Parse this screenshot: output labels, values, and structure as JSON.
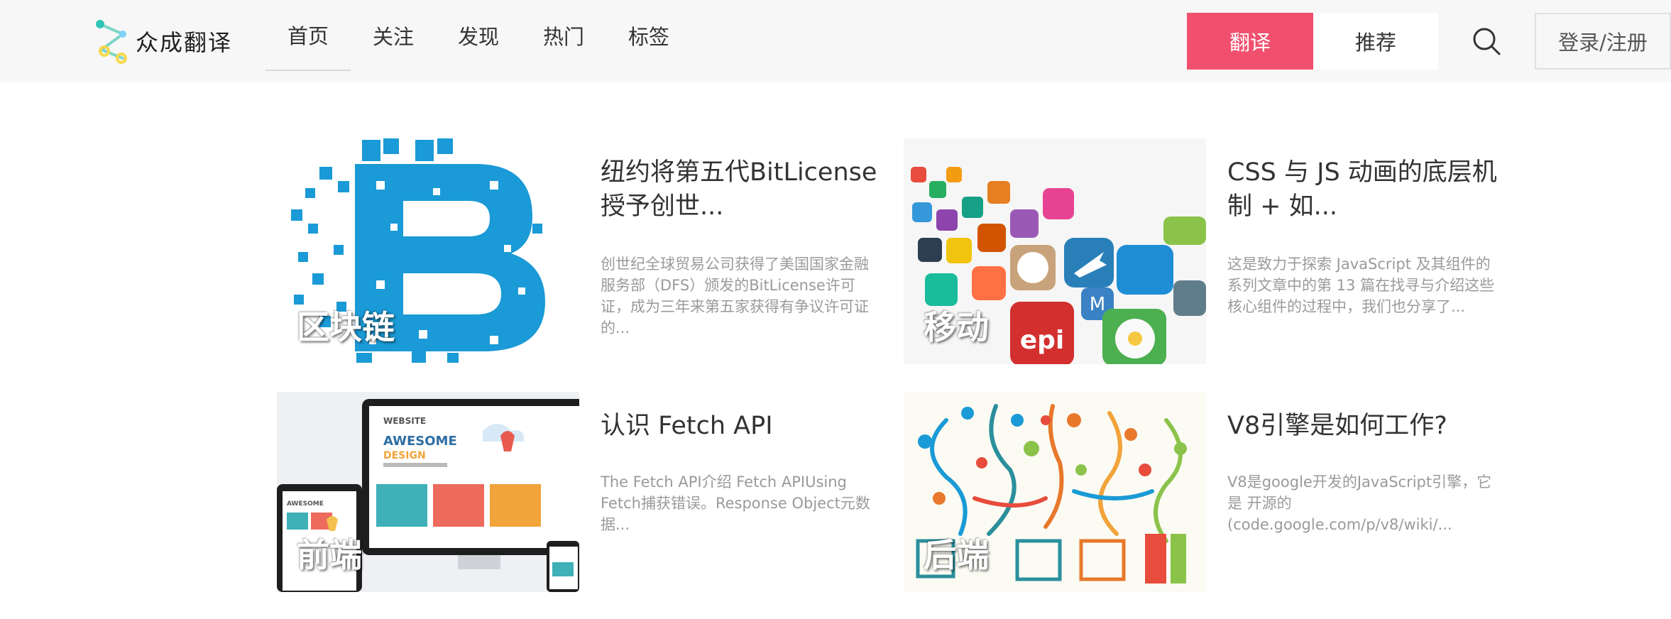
{
  "header": {
    "logo_text": "众成翻译",
    "nav": [
      "首页",
      "关注",
      "发现",
      "热门",
      "标签"
    ],
    "translate_label": "翻译",
    "recommend_label": "推荐",
    "login_label": "登录/注册"
  },
  "colors": {
    "accent": "#f0506e",
    "header_bg": "#f7f7f7"
  },
  "articles": [
    {
      "title": "纽约将第五代BitLicense授予创世...",
      "desc": "创世纪全球贸易公司获得了美国国家金融服务部（DFS）颁发的BitLicense许可证，成为三年来第五家获得有争议许可证的...",
      "tag": "区块链",
      "image_icon": "bitcoin-pixel-image"
    },
    {
      "title": "CSS 与 JS 动画的底层机制 + 如...",
      "desc": "这是致力于探索 JavaScript 及其组件的系列文章中的第 13 篇在找寻与介绍这些核心组件的过程中，我们也分享了...",
      "tag": "移动",
      "image_icon": "app-icons-image"
    },
    {
      "title": "认识 Fetch API",
      "desc": "The Fetch API介绍 Fetch APIUsing Fetch捕获错误。Response Object元数据...",
      "tag": "前端",
      "image_icon": "responsive-devices-image",
      "image_text": {
        "website": "WEBSITE",
        "awesome": "AWESOME",
        "design": "DESIGN",
        "awesome2": "AWESOME"
      }
    },
    {
      "title": "V8引擎是如何工作?",
      "desc": "V8是google开发的JavaScript引擎，它是 开源的(code.google.com/p/v8/wiki/...",
      "tag": "后端",
      "image_icon": "tech-cloud-tree-image"
    }
  ]
}
